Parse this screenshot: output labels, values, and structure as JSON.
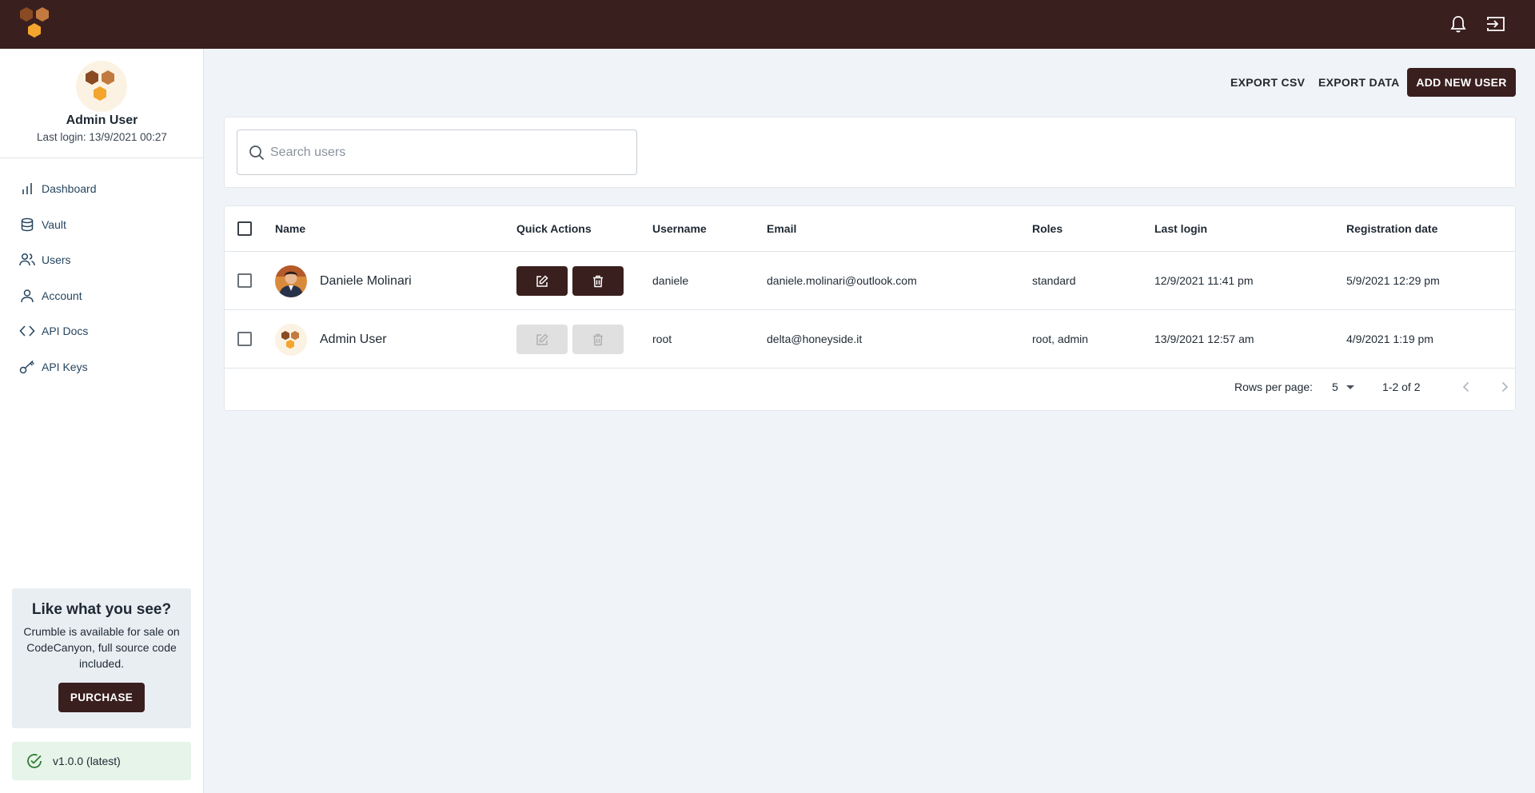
{
  "header": {
    "logo": "honeycomb-logo",
    "icons": [
      "bell-icon",
      "exit-icon"
    ]
  },
  "sidebar": {
    "user_name": "Admin User",
    "last_login": "Last login: 13/9/2021 00:27",
    "items": [
      {
        "label": "Dashboard",
        "icon": "bar-chart-icon"
      },
      {
        "label": "Vault",
        "icon": "database-icon"
      },
      {
        "label": "Users",
        "icon": "users-icon"
      },
      {
        "label": "Account",
        "icon": "user-icon"
      },
      {
        "label": "API Docs",
        "icon": "code-icon"
      },
      {
        "label": "API Keys",
        "icon": "key-icon"
      }
    ],
    "promo": {
      "title": "Like what you see?",
      "text": "Crumble is available for sale on CodeCanyon, full source code included.",
      "button": "PURCHASE"
    },
    "version": "v1.0.0 (latest)"
  },
  "toolbar": {
    "export_csv": "EXPORT CSV",
    "export_data": "EXPORT DATA",
    "add_user": "ADD NEW USER"
  },
  "search": {
    "placeholder": "Search users"
  },
  "table": {
    "columns": [
      "Name",
      "Quick Actions",
      "Username",
      "Email",
      "Roles",
      "Last login",
      "Registration date"
    ],
    "rows": [
      {
        "name": "Daniele Molinari",
        "username": "daniele",
        "email": "daniele.molinari@outlook.com",
        "roles": "standard",
        "last_login": "12/9/2021 11:41 pm",
        "registration": "5/9/2021 12:29 pm",
        "actions_enabled": true
      },
      {
        "name": "Admin User",
        "username": "root",
        "email": "delta@honeyside.it",
        "roles": "root, admin",
        "last_login": "13/9/2021 12:57 am",
        "registration": "4/9/2021 1:19 pm",
        "actions_enabled": false
      }
    ]
  },
  "pagination": {
    "rows_per_page_label": "Rows per page:",
    "rows_per_page": "5",
    "range": "1-2 of 2"
  },
  "colors": {
    "brand_dark": "#3a1f1f",
    "honey_dark": "#8a4b22",
    "honey_mid": "#c27a3e",
    "honey_light": "#f4a52d"
  }
}
